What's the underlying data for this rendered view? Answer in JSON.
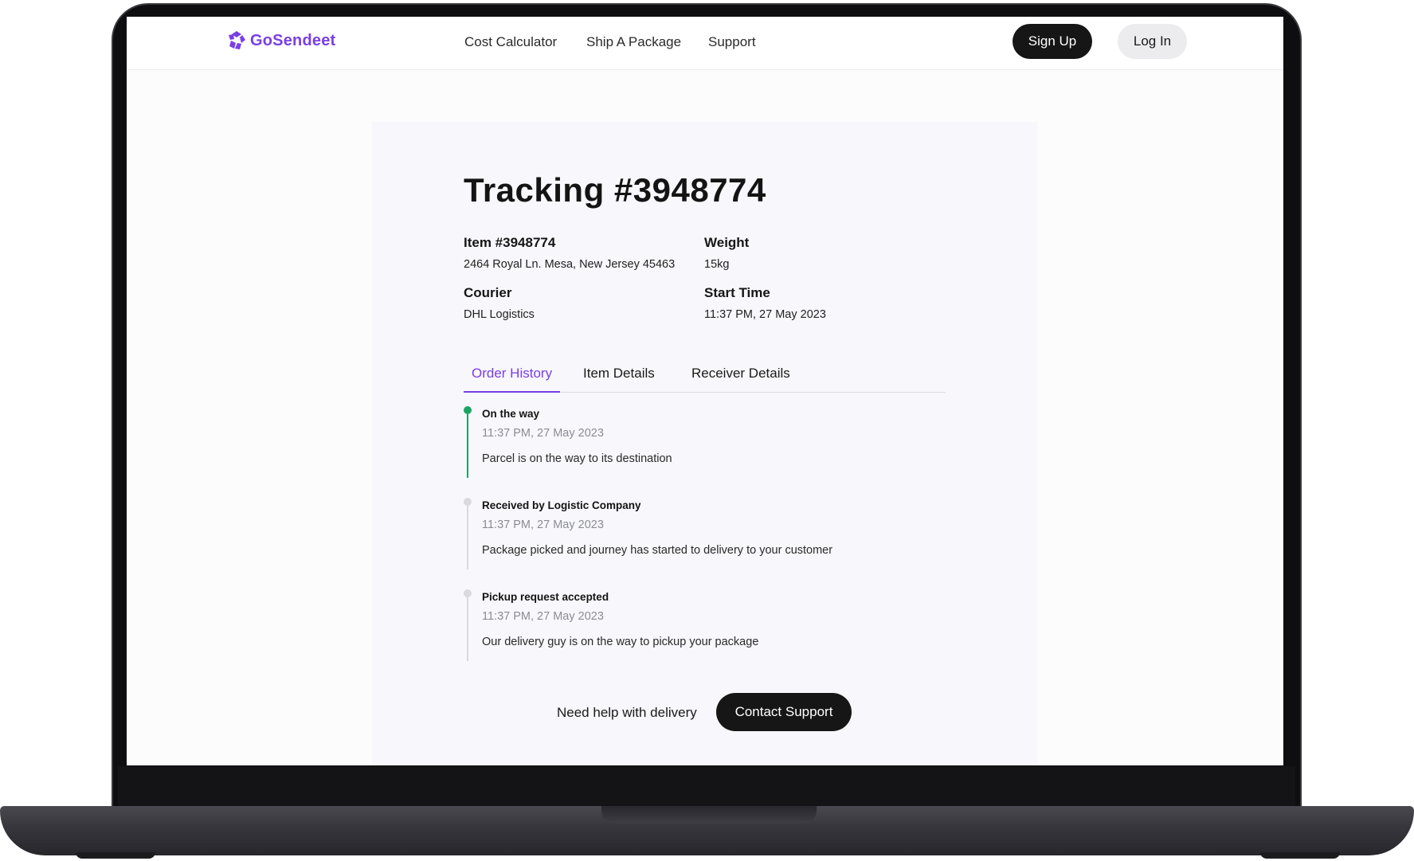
{
  "brand": {
    "name": "GoSendeet",
    "color": "#7b3fe4"
  },
  "nav": {
    "links": [
      "Cost Calculator",
      "Ship A Package",
      "Support"
    ],
    "signup_label": "Sign Up",
    "login_label": "Log In"
  },
  "tracking": {
    "title": "Tracking #3948774",
    "item_label": "Item #3948774",
    "item_address": "2464 Royal Ln. Mesa, New Jersey 45463",
    "weight_label": "Weight",
    "weight_value": "15kg",
    "courier_label": "Courier",
    "courier_value": "DHL Logistics",
    "start_label": "Start Time",
    "start_value": "11:37 PM, 27 May 2023"
  },
  "tabs": [
    {
      "label": "Order History",
      "active": true
    },
    {
      "label": "Item Details",
      "active": false
    },
    {
      "label": "Receiver Details",
      "active": false
    }
  ],
  "history": [
    {
      "title": "On the way",
      "time": "11:37 PM, 27 May 2023",
      "description": "Parcel is on the way to its destination",
      "status_color": "#1aa564"
    },
    {
      "title": "Received by Logistic Company",
      "time": "11:37 PM, 27 May 2023",
      "description": "Package picked and journey has started to delivery to your customer",
      "status_color": "#d9d9de"
    },
    {
      "title": "Pickup request accepted",
      "time": "11:37 PM, 27 May 2023",
      "description": "Our delivery guy is on the way to pickup your package",
      "status_color": "#d9d9de"
    }
  ],
  "help": {
    "text": "Need help with delivery",
    "button_label": "Contact Support"
  }
}
